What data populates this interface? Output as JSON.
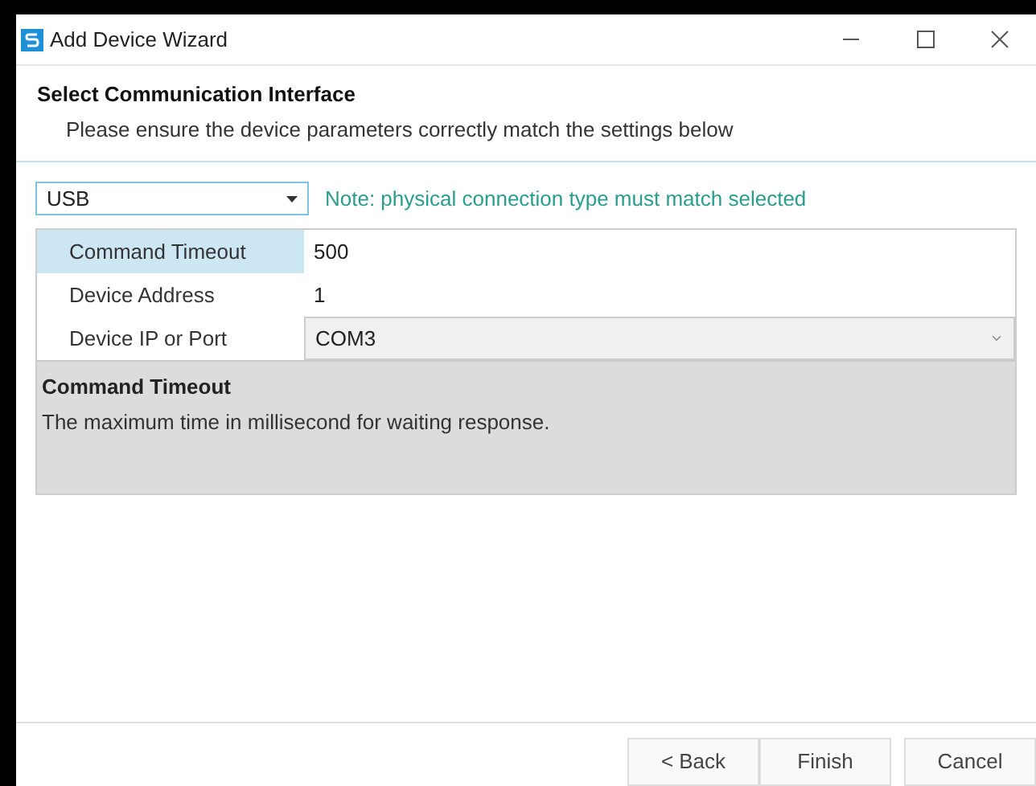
{
  "window": {
    "title": "Add Device Wizard"
  },
  "header": {
    "title": "Select Communication Interface",
    "subtitle": "Please ensure the device parameters correctly match the settings below"
  },
  "interface": {
    "value": "USB",
    "note": "Note: physical connection type must match selected"
  },
  "properties": [
    {
      "name": "Command Timeout",
      "value": "500",
      "kind": "text",
      "selected": true
    },
    {
      "name": "Device Address",
      "value": "1",
      "kind": "text",
      "selected": false
    },
    {
      "name": "Device IP or Port",
      "value": "COM3",
      "kind": "dropdown",
      "selected": false
    }
  ],
  "description": {
    "title": "Command Timeout",
    "text": "The maximum time in millisecond for waiting response."
  },
  "buttons": [
    "< Back",
    "Finish",
    "Cancel"
  ]
}
